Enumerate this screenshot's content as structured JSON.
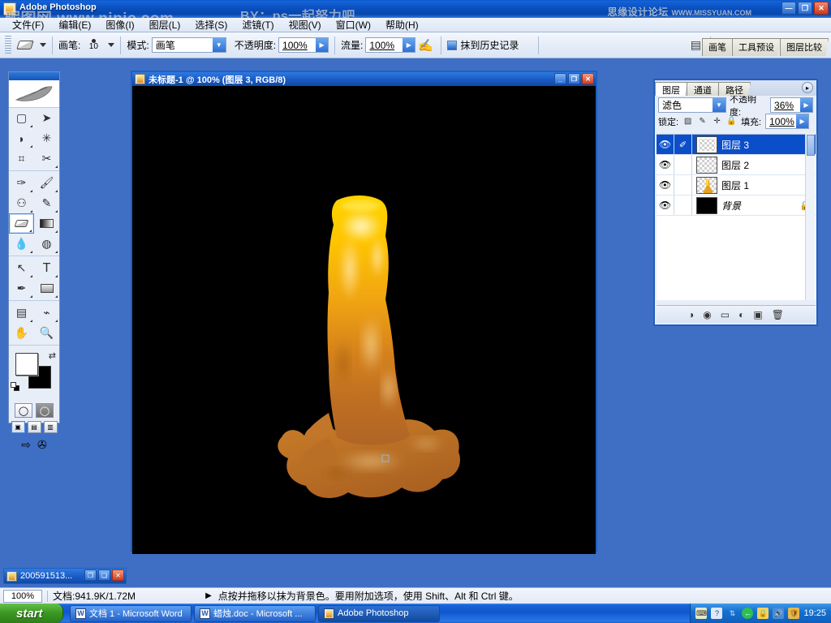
{
  "app": {
    "title": "Adobe Photoshop",
    "watermark_left": "昵图网 www.nipic.com",
    "watermark_center": "BY：ps一起努力吧",
    "watermark_right": "思缘设计论坛",
    "watermark_right_url": "WWW.MISSYUAN.COM",
    "min_label": "—",
    "restore_label": "❐",
    "close_label": "✕"
  },
  "menubar": {
    "items": [
      {
        "label": "文件(F)"
      },
      {
        "label": "编辑(E)"
      },
      {
        "label": "图像(I)"
      },
      {
        "label": "图层(L)"
      },
      {
        "label": "选择(S)"
      },
      {
        "label": "滤镜(T)"
      },
      {
        "label": "视图(V)"
      },
      {
        "label": "窗口(W)"
      },
      {
        "label": "帮助(H)"
      }
    ]
  },
  "options_bar": {
    "tool_name": "eraser-tool",
    "brush_label": "画笔:",
    "brush_size": "10",
    "mode_label": "模式:",
    "mode_value": "画笔",
    "opacity_label": "不透明度:",
    "opacity_value": "100%",
    "flow_label": "流量:",
    "flow_value": "100%",
    "erase_to_history_label": "抹到历史记录",
    "dropdown_arrow": "▼",
    "spinner_arrow": "▶",
    "palette_tabs": [
      {
        "label": "画笔"
      },
      {
        "label": "工具预设"
      },
      {
        "label": "图层比较"
      }
    ]
  },
  "toolbox": {
    "tools": [
      {
        "name": "rectangular-marquee-tool",
        "glyph": "▢",
        "has_submenu": true,
        "selected": false
      },
      {
        "name": "move-tool",
        "glyph": "➤",
        "has_submenu": false,
        "selected": false
      },
      {
        "name": "lasso-tool",
        "glyph": "◗",
        "has_submenu": true,
        "selected": false
      },
      {
        "name": "magic-wand-tool",
        "glyph": "✳",
        "has_submenu": false,
        "selected": false
      },
      {
        "name": "crop-tool",
        "glyph": "⌗",
        "has_submenu": false,
        "selected": false
      },
      {
        "name": "slice-tool",
        "glyph": "✂",
        "has_submenu": true,
        "selected": false
      },
      {
        "name": "healing-brush-tool",
        "glyph": "✑",
        "has_submenu": true,
        "selected": false
      },
      {
        "name": "brush-tool",
        "glyph": "🖌",
        "has_submenu": true,
        "selected": false
      },
      {
        "name": "clone-stamp-tool",
        "glyph": "⚇",
        "has_submenu": true,
        "selected": false
      },
      {
        "name": "history-brush-tool",
        "glyph": "✎",
        "has_submenu": true,
        "selected": false
      },
      {
        "name": "eraser-tool",
        "glyph": "",
        "has_submenu": true,
        "selected": true
      },
      {
        "name": "gradient-tool",
        "glyph": "▬",
        "has_submenu": true,
        "selected": false
      },
      {
        "name": "blur-tool",
        "glyph": "💧",
        "has_submenu": true,
        "selected": false
      },
      {
        "name": "dodge-tool",
        "glyph": "◍",
        "has_submenu": true,
        "selected": false
      },
      {
        "name": "path-selection-tool",
        "glyph": "↖",
        "has_submenu": true,
        "selected": false
      },
      {
        "name": "type-tool",
        "glyph": "T",
        "has_submenu": true,
        "selected": false
      },
      {
        "name": "pen-tool",
        "glyph": "✒",
        "has_submenu": true,
        "selected": false
      },
      {
        "name": "rectangle-shape-tool",
        "glyph": "▭",
        "has_submenu": true,
        "selected": false
      },
      {
        "name": "notes-tool",
        "glyph": "▤",
        "has_submenu": true,
        "selected": false
      },
      {
        "name": "eyedropper-tool",
        "glyph": "⌁",
        "has_submenu": true,
        "selected": false
      },
      {
        "name": "hand-tool",
        "glyph": "✋",
        "has_submenu": false,
        "selected": false
      },
      {
        "name": "zoom-tool",
        "glyph": "🔍",
        "has_submenu": false,
        "selected": false
      }
    ],
    "foreground_color": "#ffffff",
    "background_color": "#000000",
    "swap_glyph": "⇄",
    "quickmask_buttons": [
      {
        "name": "standard-mode-button",
        "glyph": "◯",
        "active": true
      },
      {
        "name": "quick-mask-mode-button",
        "glyph": "◯",
        "active": false
      }
    ],
    "screen_mode_buttons": [
      {
        "name": "standard-screen-mode-button",
        "active": true
      },
      {
        "name": "full-screen-with-menu-button",
        "active": false
      },
      {
        "name": "full-screen-mode-button",
        "active": false
      }
    ],
    "jump_buttons": [
      {
        "name": "jump-to-imageready-button",
        "glyph": "⇥"
      },
      {
        "name": "imageready-icon",
        "glyph": "✇"
      }
    ]
  },
  "document": {
    "title": "未标题-1 @ 100% (图层 3, RGB/8)",
    "min_label": "_",
    "restore_label": "❐",
    "close_label": "✕",
    "canvas_background": "#000000",
    "artwork_name": "melting-candle"
  },
  "minimized_document": {
    "title": "200591513...",
    "restore_label": "❐",
    "max_label": "❏",
    "close_label": "✕"
  },
  "layers_panel": {
    "tabs": [
      {
        "label": "图层",
        "active": true
      },
      {
        "label": "通道",
        "active": false
      },
      {
        "label": "路径",
        "active": false
      }
    ],
    "menu_glyph": "▸",
    "blend_mode": "滤色",
    "opacity_label": "不透明度:",
    "opacity_value": "36%",
    "lock_label": "锁定:",
    "fill_label": "填充:",
    "fill_value": "100%",
    "lock_icons": [
      {
        "name": "lock-transparency-icon",
        "glyph": "▨"
      },
      {
        "name": "lock-image-icon",
        "glyph": "✎"
      },
      {
        "name": "lock-position-icon",
        "glyph": "✛"
      },
      {
        "name": "lock-all-icon",
        "glyph": "🔒"
      }
    ],
    "layers": [
      {
        "name": "图层 3",
        "visible": true,
        "selected": true,
        "thumb": "transparent",
        "locked": false,
        "brush_icon": true
      },
      {
        "name": "图层 2",
        "visible": true,
        "selected": false,
        "thumb": "transparent",
        "locked": false,
        "brush_icon": false
      },
      {
        "name": "图层 1",
        "visible": true,
        "selected": false,
        "thumb": "candle",
        "locked": false,
        "brush_icon": false
      },
      {
        "name": "背景",
        "visible": true,
        "selected": false,
        "thumb": "black",
        "locked": true,
        "brush_icon": false
      }
    ],
    "eye_glyph": "👁",
    "brush_glyph": "✐",
    "lock_glyph": "🔒",
    "bottom_buttons": [
      {
        "name": "layer-style-button",
        "glyph": "◑"
      },
      {
        "name": "layer-mask-button",
        "glyph": "◉"
      },
      {
        "name": "new-group-button",
        "glyph": "▭"
      },
      {
        "name": "adjustment-layer-button",
        "glyph": "◐"
      },
      {
        "name": "new-layer-button",
        "glyph": "▣"
      },
      {
        "name": "delete-layer-button",
        "glyph": "🗑"
      }
    ]
  },
  "status_bar": {
    "zoom": "100%",
    "doc_info": "文档:941.9K/1.72M",
    "arrow_glyph": "▶",
    "hint": "点按并拖移以抹为背景色。要用附加选项，使用 Shift、Alt 和 Ctrl 键。"
  },
  "taskbar": {
    "start_label": "start",
    "items": [
      {
        "label": "文档 1 - Microsoft Word",
        "icon": "word-icon",
        "active": false
      },
      {
        "label": "蜡烛.doc - Microsoft ...",
        "icon": "word-icon",
        "active": false
      },
      {
        "label": "Adobe Photoshop",
        "icon": "photoshop-icon",
        "active": true
      }
    ],
    "tray_icons": [
      {
        "name": "keyboard-layout-icon",
        "glyph": "⌨",
        "color": "#e8e8c8"
      },
      {
        "name": "help-icon",
        "glyph": "?",
        "color": "#dfe9f7"
      },
      {
        "name": "network-icon",
        "glyph": "⇅",
        "color": "#cfe0f5"
      },
      {
        "name": "back-arrow-icon",
        "glyph": "←",
        "color": "#2fbf4f"
      },
      {
        "name": "security-icon",
        "glyph": "🔒",
        "color": "#f5d25a"
      },
      {
        "name": "volume-icon",
        "glyph": "🔊",
        "color": "#9ec8f0"
      },
      {
        "name": "shield-icon",
        "glyph": "🛡",
        "color": "#e8b84a"
      }
    ],
    "clock": "19:25"
  }
}
